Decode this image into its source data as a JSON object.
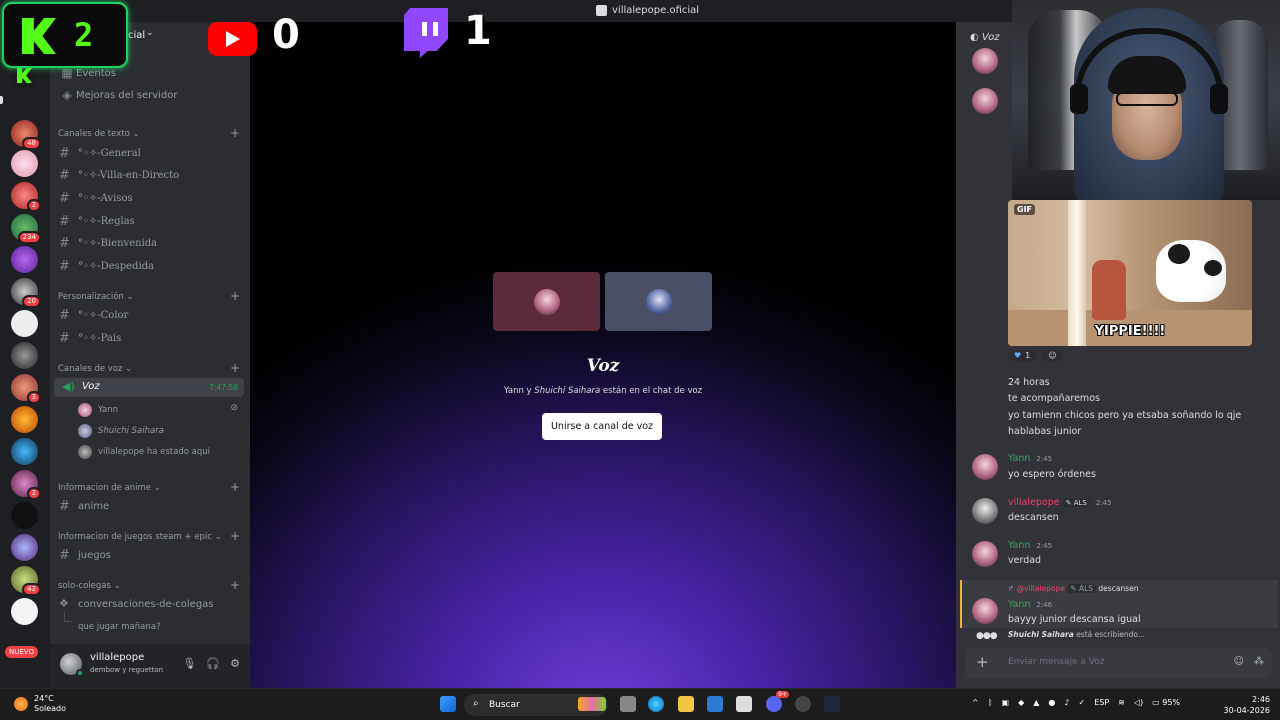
{
  "window": {
    "title": "villalepope.oficial"
  },
  "server": {
    "name_partial": "cial"
  },
  "overlay": {
    "kick_count": "2",
    "youtube_count": "0",
    "twitch_count": "1"
  },
  "sidebar": {
    "top_items": [
      "Eventos",
      "Mejoras del servidor"
    ],
    "categories": {
      "text": "Canales de texto",
      "custom": "Personalización",
      "voice": "Canales de voz",
      "anime": "Informacion de anime",
      "games": "Informacion de juegos steam + epic",
      "friends": "solo-colegas"
    },
    "text_channels": [
      "°◦✧-General",
      "°◦✧-Villa-en-Directo",
      "°◦✧-Avisos",
      "°◦✧-Reglas",
      "°◦✧-Bienvenida",
      "°◦✧-Despedida"
    ],
    "custom_channels": [
      "°◦✧-Color",
      "°◦✧-Pais"
    ],
    "voice_channel": {
      "name": "Voz",
      "time": "7:47:58"
    },
    "voice_users": [
      "Yann",
      "Shuichi Saihara",
      "villalepope ha estado aquí"
    ],
    "anime_channel": "anime",
    "games_channel": "juegos",
    "friends_channel": "conversaciones-de-colegas",
    "friends_thread": "que jugar mañana?"
  },
  "servers": {
    "badges": [
      "48",
      "2",
      "234",
      "20",
      "3",
      "2",
      "42"
    ],
    "nuevo": "NUEVO"
  },
  "user": {
    "name": "villalepope",
    "status": "dembow y reguetton"
  },
  "stage": {
    "channel": "Voz",
    "subtitle_a": "Yann y ",
    "subtitle_b": "Shuichi Saihara",
    "subtitle_c": " están en el chat de voz",
    "join_label": "Unirse a canal de voz"
  },
  "chat": {
    "header": "Voz",
    "gif_label": "GIF",
    "gif_caption": "YIPPIE!!!!",
    "reaction_count": "1",
    "lines": [
      "24 horas",
      "te acompañaremos",
      "yo tamienn chicos pero ya etsaba soñando lo qje",
      "hablabas junior"
    ],
    "messages": [
      {
        "author": "Yann",
        "time": "2:45",
        "text": "yo espero órdenes"
      },
      {
        "author": "villalepope",
        "tag": "ALS",
        "time": "2:45",
        "text": "descansen"
      },
      {
        "author": "Yann",
        "time": "2:45",
        "text": "verdad"
      },
      {
        "author": "Yann",
        "time": "2:46",
        "text": "bayyy junior descansa igual"
      }
    ],
    "reply": {
      "user": "@villalepope",
      "tag": "ALS",
      "text": "descansen"
    },
    "typing_user": "Shuichi Saihara",
    "typing_suffix": " está escribiendo...",
    "placeholder": "Enviar mensaje a Voz"
  },
  "taskbar": {
    "temp": "24°C",
    "weather": "Soleado",
    "search": "Buscar",
    "lang": "ESP",
    "battery": "95%",
    "time": "2:46",
    "date": "30-04-2026",
    "discord_badge": "9+"
  },
  "colors": {
    "accent": "#5865f2",
    "online": "#23a55a",
    "yann": "#3ba55d",
    "villa": "#f0416b",
    "kick": "#53fc18",
    "twitch": "#9146ff",
    "youtube": "#ff0000"
  }
}
